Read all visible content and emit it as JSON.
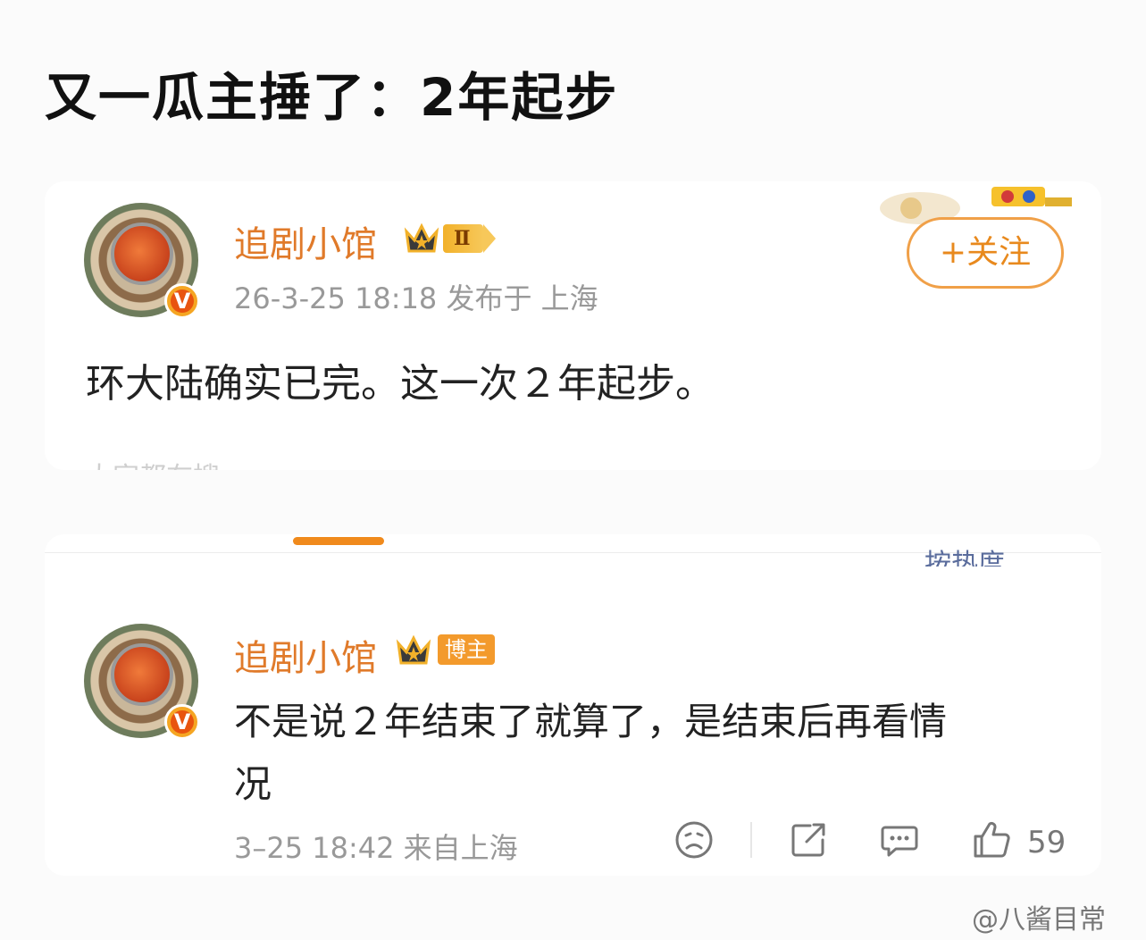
{
  "page_title": "又一瓜主捶了：2年起步",
  "post": {
    "username": "追剧小馆",
    "level": "Ⅱ",
    "meta": "26-3-25 18:18  发布于 上海",
    "follow_label": "+关注",
    "content": "环大陆确实已完。这一次２年起步。",
    "verified_badge": "V",
    "faded_partial": "大家都在搜"
  },
  "comments_header": {
    "sort_label": "按热度"
  },
  "comment": {
    "username": "追剧小馆",
    "blogger_badge": "博主",
    "content_line1": "不是说２年结束了就算了，是结束后再看情",
    "content_line2": "况",
    "verified_badge": "V",
    "meta": "3–25 18:42  来自上海",
    "like_count": "59",
    "icons": [
      "sad-face-icon",
      "share-icon",
      "comment-icon",
      "thumbs-up-icon"
    ]
  },
  "watermark": "@八酱目常",
  "colors": {
    "username": "#e07a2a",
    "accent": "#f08a1c",
    "meta": "#999999",
    "sort_label": "#5a6c9c"
  }
}
